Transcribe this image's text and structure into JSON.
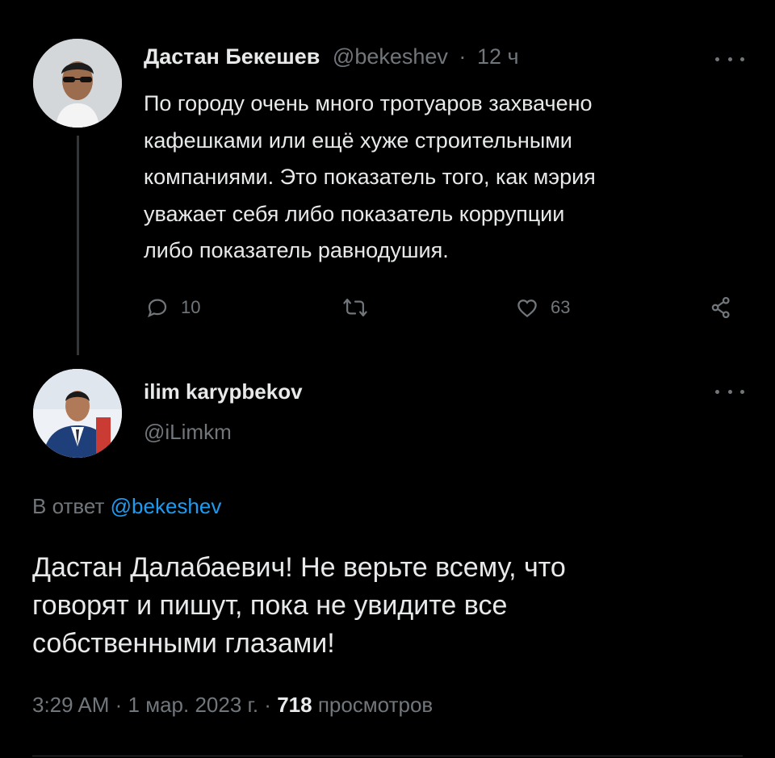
{
  "tweet": {
    "author_name": "Дастан Бекешев",
    "author_handle": "@bekeshev",
    "separator": "·",
    "time": "12 ч",
    "lines": [
      "По городу очень много тротуаров захвачено",
      "кафешками или ещё хуже строительными",
      "компаниями. Это показатель того, как мэрия",
      "уважает себя либо показатель коррупции",
      "либо показатель равнодушия."
    ],
    "actions": {
      "replies": "10",
      "retweets": "",
      "likes": "63"
    }
  },
  "reply": {
    "author_name": "ilim karypbekov",
    "author_handle": "@iLimkm",
    "replying_prefix": "В ответ",
    "replying_handle": "@bekeshev",
    "lines": [
      "Дастан Далабаевич! Не верьте всему, что",
      "говорят и пишут, пока не увидите все",
      "собственными глазами!"
    ],
    "time": "3:29 AM",
    "date": "1 мар. 2023 г.",
    "views_count": "718",
    "views_label": "просмотров"
  },
  "colors": {
    "background": "#000000",
    "text": "#e7e9ea",
    "muted": "#71767b",
    "link": "#1d9bf0"
  },
  "icons": [
    "reply-icon",
    "retweet-icon",
    "like-icon",
    "share-icon",
    "more-icon"
  ]
}
